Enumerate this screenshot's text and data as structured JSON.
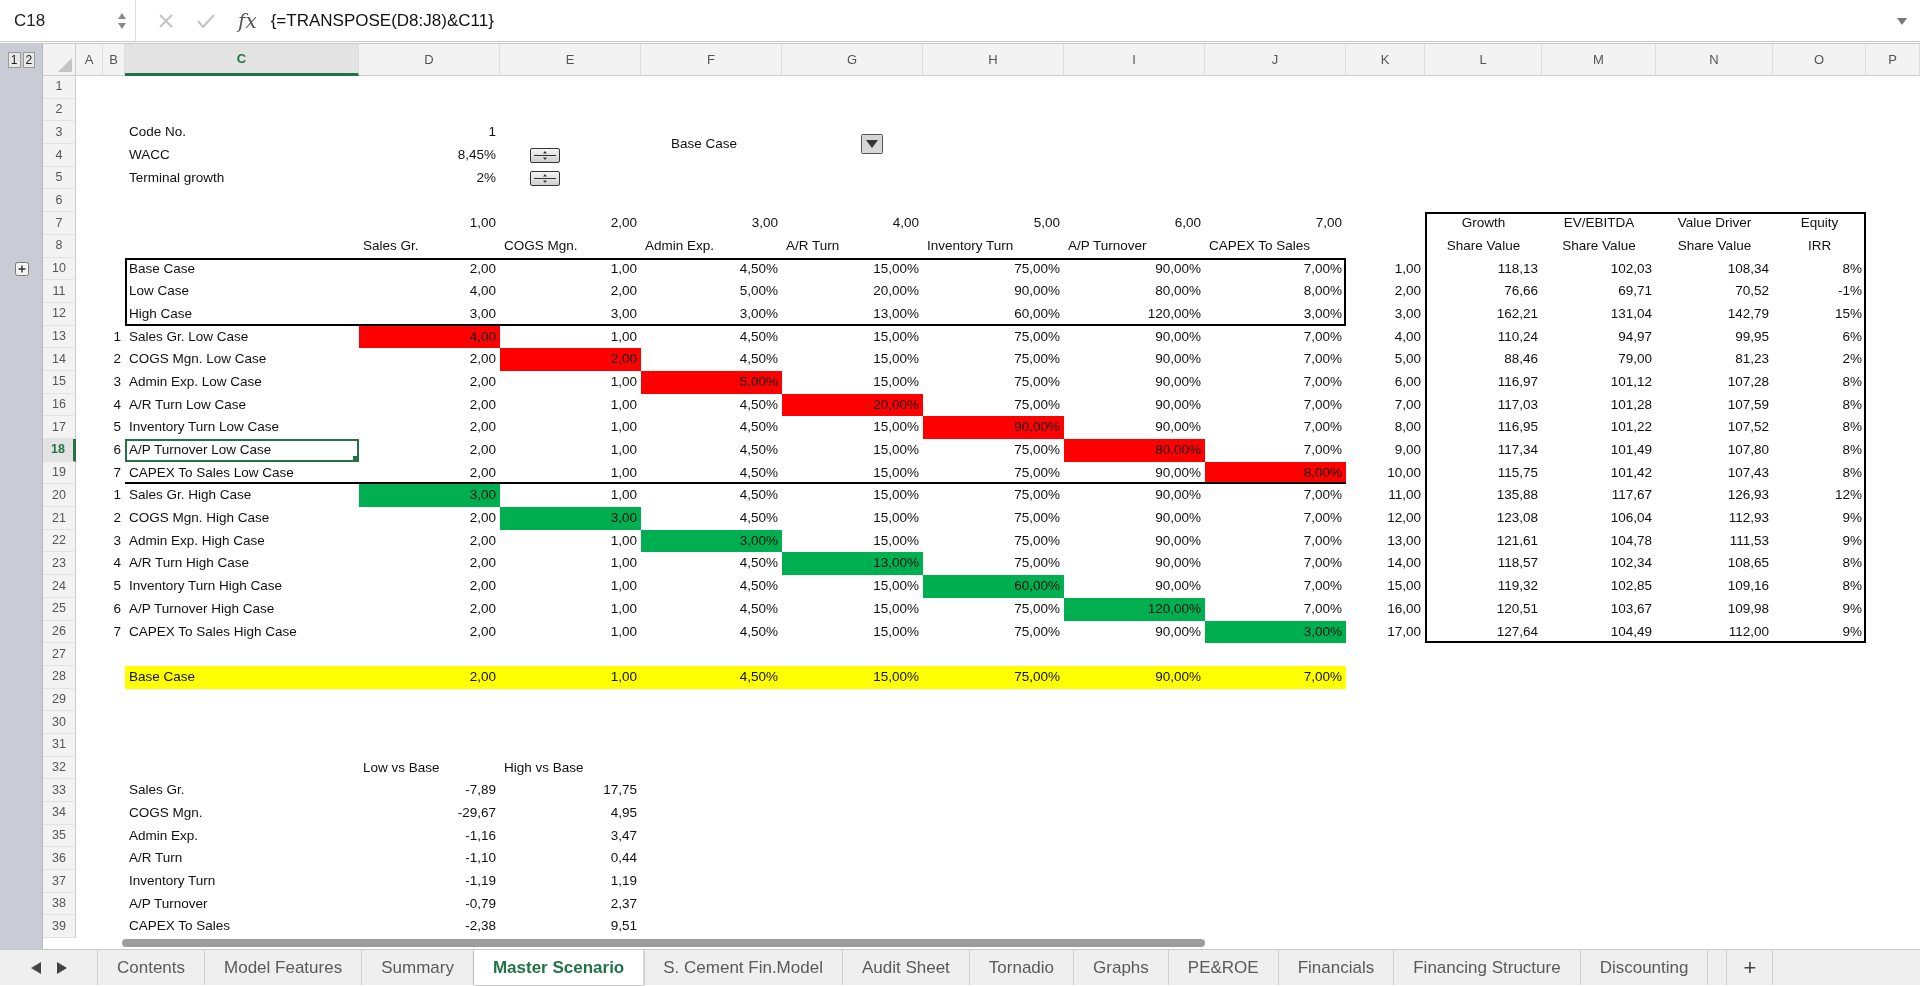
{
  "formula_bar": {
    "cell_reference": "C18",
    "function_label": "fx",
    "formula": "{=TRANSPOSE(D8:J8)&C11}"
  },
  "outline_levels": [
    "1",
    "2"
  ],
  "columns": [
    {
      "label": "A",
      "selected": false
    },
    {
      "label": "B",
      "selected": false
    },
    {
      "label": "C",
      "selected": true
    },
    {
      "label": "D",
      "selected": false
    },
    {
      "label": "E",
      "selected": false
    },
    {
      "label": "F",
      "selected": false
    },
    {
      "label": "G",
      "selected": false
    },
    {
      "label": "H",
      "selected": false
    },
    {
      "label": "I",
      "selected": false
    },
    {
      "label": "J",
      "selected": false
    },
    {
      "label": "K",
      "selected": false
    },
    {
      "label": "L",
      "selected": false
    },
    {
      "label": "M",
      "selected": false
    },
    {
      "label": "N",
      "selected": false
    },
    {
      "label": "O",
      "selected": false
    },
    {
      "label": "P",
      "selected": false
    }
  ],
  "rows": [
    {
      "number": "1",
      "selected": false,
      "cells": []
    },
    {
      "number": "2",
      "selected": false,
      "cells": []
    },
    {
      "number": "3",
      "selected": false,
      "cells": [
        {
          "kind": "blank"
        },
        {
          "kind": "blank"
        },
        {
          "kind": "text",
          "text": "Code No."
        },
        {
          "kind": "number",
          "text": "1"
        },
        {
          "kind": "blank"
        },
        {
          "kind": "dropdown",
          "text": "Base Case"
        }
      ]
    },
    {
      "number": "4",
      "selected": false,
      "cells": [
        {
          "kind": "blank"
        },
        {
          "kind": "blank"
        },
        {
          "kind": "text",
          "text": "WACC"
        },
        {
          "kind": "number",
          "text": "8,45%"
        },
        {
          "kind": "spinner"
        }
      ]
    },
    {
      "number": "5",
      "selected": false,
      "cells": [
        {
          "kind": "blank"
        },
        {
          "kind": "blank"
        },
        {
          "kind": "text",
          "text": "Terminal growth"
        },
        {
          "kind": "number",
          "text": "2%"
        },
        {
          "kind": "spinner"
        }
      ]
    },
    {
      "number": "6",
      "selected": false,
      "cells": []
    },
    {
      "number": "7",
      "selected": false,
      "cells": [
        {
          "kind": "blank"
        },
        {
          "kind": "blank"
        },
        {
          "kind": "blank"
        },
        {
          "kind": "number",
          "text": "1,00"
        },
        {
          "kind": "number",
          "text": "2,00"
        },
        {
          "kind": "number",
          "text": "3,00"
        },
        {
          "kind": "number",
          "text": "4,00"
        },
        {
          "kind": "number",
          "text": "5,00"
        },
        {
          "kind": "number",
          "text": "6,00"
        },
        {
          "kind": "number",
          "text": "7,00"
        },
        {
          "kind": "blank"
        },
        {
          "kind": "heading",
          "text": "Growth"
        },
        {
          "kind": "heading",
          "text": "EV/EBITDA"
        },
        {
          "kind": "heading",
          "text": "Value Driver"
        },
        {
          "kind": "heading",
          "text": "Equity"
        }
      ]
    },
    {
      "number": "8",
      "selected": false,
      "cells": [
        {
          "kind": "blank"
        },
        {
          "kind": "blank"
        },
        {
          "kind": "blank"
        },
        {
          "kind": "text",
          "text": "Sales Gr."
        },
        {
          "kind": "text",
          "text": "COGS Mgn."
        },
        {
          "kind": "text",
          "text": "Admin Exp."
        },
        {
          "kind": "text",
          "text": "A/R Turn"
        },
        {
          "kind": "text",
          "text": "Inventory Turn"
        },
        {
          "kind": "text",
          "text": "A/P Turnover"
        },
        {
          "kind": "text",
          "text": "CAPEX To Sales"
        },
        {
          "kind": "blank"
        },
        {
          "kind": "heading",
          "text": "Share Value"
        },
        {
          "kind": "heading",
          "text": "Share Value"
        },
        {
          "kind": "heading",
          "text": "Share Value"
        },
        {
          "kind": "heading",
          "text": "IRR"
        }
      ]
    },
    {
      "number": "10",
      "selected": false,
      "cells": [
        {
          "kind": "blank"
        },
        {
          "kind": "blank"
        },
        {
          "kind": "text",
          "text": "Base Case"
        },
        {
          "kind": "number",
          "text": "2,00"
        },
        {
          "kind": "number",
          "text": "1,00"
        },
        {
          "kind": "number",
          "text": "4,50%"
        },
        {
          "kind": "number",
          "text": "15,00%"
        },
        {
          "kind": "number",
          "text": "75,00%"
        },
        {
          "kind": "number",
          "text": "90,00%"
        },
        {
          "kind": "number",
          "text": "7,00%"
        },
        {
          "kind": "number",
          "text": "1,00"
        },
        {
          "kind": "number",
          "text": "118,13"
        },
        {
          "kind": "number",
          "text": "102,03"
        },
        {
          "kind": "number",
          "text": "108,34"
        },
        {
          "kind": "number",
          "text": "8%"
        }
      ]
    },
    {
      "number": "11",
      "selected": false,
      "cells": [
        {
          "kind": "blank"
        },
        {
          "kind": "blank"
        },
        {
          "kind": "text",
          "text": "Low Case"
        },
        {
          "kind": "number",
          "text": "4,00"
        },
        {
          "kind": "number",
          "text": "2,00"
        },
        {
          "kind": "number",
          "text": "5,00%"
        },
        {
          "kind": "number",
          "text": "20,00%"
        },
        {
          "kind": "number",
          "text": "90,00%"
        },
        {
          "kind": "number",
          "text": "80,00%"
        },
        {
          "kind": "number",
          "text": "8,00%"
        },
        {
          "kind": "number",
          "text": "2,00"
        },
        {
          "kind": "number",
          "text": "76,66"
        },
        {
          "kind": "number",
          "text": "69,71"
        },
        {
          "kind": "number",
          "text": "70,52"
        },
        {
          "kind": "number",
          "text": "-1%"
        }
      ]
    },
    {
      "number": "12",
      "selected": false,
      "cells": [
        {
          "kind": "blank"
        },
        {
          "kind": "blank"
        },
        {
          "kind": "text",
          "text": "High Case"
        },
        {
          "kind": "number",
          "text": "3,00"
        },
        {
          "kind": "number",
          "text": "3,00"
        },
        {
          "kind": "number",
          "text": "3,00%"
        },
        {
          "kind": "number",
          "text": "13,00%"
        },
        {
          "kind": "number",
          "text": "60,00%"
        },
        {
          "kind": "number",
          "text": "120,00%"
        },
        {
          "kind": "number",
          "text": "3,00%"
        },
        {
          "kind": "number",
          "text": "3,00"
        },
        {
          "kind": "number",
          "text": "162,21"
        },
        {
          "kind": "number",
          "text": "131,04"
        },
        {
          "kind": "number",
          "text": "142,79"
        },
        {
          "kind": "number",
          "text": "15%"
        }
      ]
    },
    {
      "number": "13",
      "selected": false,
      "cells": [
        {
          "kind": "blank"
        },
        {
          "kind": "number",
          "text": "1"
        },
        {
          "kind": "text",
          "text": "Sales Gr. Low Case"
        },
        {
          "kind": "number",
          "text": "4,00",
          "color": "#ff0000"
        },
        {
          "kind": "number",
          "text": "1,00"
        },
        {
          "kind": "number",
          "text": "4,50%"
        },
        {
          "kind": "number",
          "text": "15,00%"
        },
        {
          "kind": "number",
          "text": "75,00%"
        },
        {
          "kind": "number",
          "text": "90,00%"
        },
        {
          "kind": "number",
          "text": "7,00%"
        },
        {
          "kind": "number",
          "text": "4,00"
        },
        {
          "kind": "number",
          "text": "110,24"
        },
        {
          "kind": "number",
          "text": "94,97"
        },
        {
          "kind": "number",
          "text": "99,95"
        },
        {
          "kind": "number",
          "text": "6%"
        }
      ]
    },
    {
      "number": "14",
      "selected": false,
      "cells": [
        {
          "kind": "blank"
        },
        {
          "kind": "number",
          "text": "2"
        },
        {
          "kind": "text",
          "text": "COGS Mgn. Low Case"
        },
        {
          "kind": "number",
          "text": "2,00"
        },
        {
          "kind": "number",
          "text": "2,00",
          "color": "#ff0000"
        },
        {
          "kind": "number",
          "text": "4,50%"
        },
        {
          "kind": "number",
          "text": "15,00%"
        },
        {
          "kind": "number",
          "text": "75,00%"
        },
        {
          "kind": "number",
          "text": "90,00%"
        },
        {
          "kind": "number",
          "text": "7,00%"
        },
        {
          "kind": "number",
          "text": "5,00"
        },
        {
          "kind": "number",
          "text": "88,46"
        },
        {
          "kind": "number",
          "text": "79,00"
        },
        {
          "kind": "number",
          "text": "81,23"
        },
        {
          "kind": "number",
          "text": "2%"
        }
      ]
    },
    {
      "number": "15",
      "selected": false,
      "cells": [
        {
          "kind": "blank"
        },
        {
          "kind": "number",
          "text": "3"
        },
        {
          "kind": "text",
          "text": "Admin Exp. Low Case"
        },
        {
          "kind": "number",
          "text": "2,00"
        },
        {
          "kind": "number",
          "text": "1,00"
        },
        {
          "kind": "number",
          "text": "5,00%",
          "color": "#ff0000"
        },
        {
          "kind": "number",
          "text": "15,00%"
        },
        {
          "kind": "number",
          "text": "75,00%"
        },
        {
          "kind": "number",
          "text": "90,00%"
        },
        {
          "kind": "number",
          "text": "7,00%"
        },
        {
          "kind": "number",
          "text": "6,00"
        },
        {
          "kind": "number",
          "text": "116,97"
        },
        {
          "kind": "number",
          "text": "101,12"
        },
        {
          "kind": "number",
          "text": "107,28"
        },
        {
          "kind": "number",
          "text": "8%"
        }
      ]
    },
    {
      "number": "16",
      "selected": false,
      "cells": [
        {
          "kind": "blank"
        },
        {
          "kind": "number",
          "text": "4"
        },
        {
          "kind": "text",
          "text": "A/R Turn Low Case"
        },
        {
          "kind": "number",
          "text": "2,00"
        },
        {
          "kind": "number",
          "text": "1,00"
        },
        {
          "kind": "number",
          "text": "4,50%"
        },
        {
          "kind": "number",
          "text": "20,00%",
          "color": "#ff0000"
        },
        {
          "kind": "number",
          "text": "75,00%"
        },
        {
          "kind": "number",
          "text": "90,00%"
        },
        {
          "kind": "number",
          "text": "7,00%"
        },
        {
          "kind": "number",
          "text": "7,00"
        },
        {
          "kind": "number",
          "text": "117,03"
        },
        {
          "kind": "number",
          "text": "101,28"
        },
        {
          "kind": "number",
          "text": "107,59"
        },
        {
          "kind": "number",
          "text": "8%"
        }
      ]
    },
    {
      "number": "17",
      "selected": false,
      "cells": [
        {
          "kind": "blank"
        },
        {
          "kind": "number",
          "text": "5"
        },
        {
          "kind": "text",
          "text": "Inventory Turn Low Case"
        },
        {
          "kind": "number",
          "text": "2,00"
        },
        {
          "kind": "number",
          "text": "1,00"
        },
        {
          "kind": "number",
          "text": "4,50%"
        },
        {
          "kind": "number",
          "text": "15,00%"
        },
        {
          "kind": "number",
          "text": "90,00%",
          "color": "#ff0000"
        },
        {
          "kind": "number",
          "text": "90,00%"
        },
        {
          "kind": "number",
          "text": "7,00%"
        },
        {
          "kind": "number",
          "text": "8,00"
        },
        {
          "kind": "number",
          "text": "116,95"
        },
        {
          "kind": "number",
          "text": "101,22"
        },
        {
          "kind": "number",
          "text": "107,52"
        },
        {
          "kind": "number",
          "text": "8%"
        }
      ]
    },
    {
      "number": "18",
      "selected": true,
      "cells": [
        {
          "kind": "blank"
        },
        {
          "kind": "number",
          "text": "6"
        },
        {
          "kind": "text",
          "text": "A/P Turnover Low Case"
        },
        {
          "kind": "number",
          "text": "2,00"
        },
        {
          "kind": "number",
          "text": "1,00"
        },
        {
          "kind": "number",
          "text": "4,50%"
        },
        {
          "kind": "number",
          "text": "15,00%"
        },
        {
          "kind": "number",
          "text": "75,00%"
        },
        {
          "kind": "number",
          "text": "80,00%",
          "color": "#ff0000"
        },
        {
          "kind": "number",
          "text": "7,00%"
        },
        {
          "kind": "number",
          "text": "9,00"
        },
        {
          "kind": "number",
          "text": "117,34"
        },
        {
          "kind": "number",
          "text": "101,49"
        },
        {
          "kind": "number",
          "text": "107,80"
        },
        {
          "kind": "number",
          "text": "8%"
        }
      ]
    },
    {
      "number": "19",
      "selected": false,
      "cells": [
        {
          "kind": "blank"
        },
        {
          "kind": "number",
          "text": "7"
        },
        {
          "kind": "text",
          "text": "CAPEX To Sales Low Case"
        },
        {
          "kind": "number",
          "text": "2,00"
        },
        {
          "kind": "number",
          "text": "1,00"
        },
        {
          "kind": "number",
          "text": "4,50%"
        },
        {
          "kind": "number",
          "text": "15,00%"
        },
        {
          "kind": "number",
          "text": "75,00%"
        },
        {
          "kind": "number",
          "text": "90,00%"
        },
        {
          "kind": "number",
          "text": "8,00%",
          "color": "#ff0000"
        },
        {
          "kind": "number",
          "text": "10,00"
        },
        {
          "kind": "number",
          "text": "115,75"
        },
        {
          "kind": "number",
          "text": "101,42"
        },
        {
          "kind": "number",
          "text": "107,43"
        },
        {
          "kind": "number",
          "text": "8%"
        }
      ]
    },
    {
      "number": "20",
      "selected": false,
      "cells": [
        {
          "kind": "blank"
        },
        {
          "kind": "number",
          "text": "1"
        },
        {
          "kind": "text",
          "text": "Sales Gr. High Case"
        },
        {
          "kind": "number",
          "text": "3,00",
          "color": "#00b050"
        },
        {
          "kind": "number",
          "text": "1,00"
        },
        {
          "kind": "number",
          "text": "4,50%"
        },
        {
          "kind": "number",
          "text": "15,00%"
        },
        {
          "kind": "number",
          "text": "75,00%"
        },
        {
          "kind": "number",
          "text": "90,00%"
        },
        {
          "kind": "number",
          "text": "7,00%"
        },
        {
          "kind": "number",
          "text": "11,00"
        },
        {
          "kind": "number",
          "text": "135,88"
        },
        {
          "kind": "number",
          "text": "117,67"
        },
        {
          "kind": "number",
          "text": "126,93"
        },
        {
          "kind": "number",
          "text": "12%"
        }
      ]
    },
    {
      "number": "21",
      "selected": false,
      "cells": [
        {
          "kind": "blank"
        },
        {
          "kind": "number",
          "text": "2"
        },
        {
          "kind": "text",
          "text": "COGS Mgn. High Case"
        },
        {
          "kind": "number",
          "text": "2,00"
        },
        {
          "kind": "number",
          "text": "3,00",
          "color": "#00b050"
        },
        {
          "kind": "number",
          "text": "4,50%"
        },
        {
          "kind": "number",
          "text": "15,00%"
        },
        {
          "kind": "number",
          "text": "75,00%"
        },
        {
          "kind": "number",
          "text": "90,00%"
        },
        {
          "kind": "number",
          "text": "7,00%"
        },
        {
          "kind": "number",
          "text": "12,00"
        },
        {
          "kind": "number",
          "text": "123,08"
        },
        {
          "kind": "number",
          "text": "106,04"
        },
        {
          "kind": "number",
          "text": "112,93"
        },
        {
          "kind": "number",
          "text": "9%"
        }
      ]
    },
    {
      "number": "22",
      "selected": false,
      "cells": [
        {
          "kind": "blank"
        },
        {
          "kind": "number",
          "text": "3"
        },
        {
          "kind": "text",
          "text": "Admin Exp. High Case"
        },
        {
          "kind": "number",
          "text": "2,00"
        },
        {
          "kind": "number",
          "text": "1,00"
        },
        {
          "kind": "number",
          "text": "3,00%",
          "color": "#00b050"
        },
        {
          "kind": "number",
          "text": "15,00%"
        },
        {
          "kind": "number",
          "text": "75,00%"
        },
        {
          "kind": "number",
          "text": "90,00%"
        },
        {
          "kind": "number",
          "text": "7,00%"
        },
        {
          "kind": "number",
          "text": "13,00"
        },
        {
          "kind": "number",
          "text": "121,61"
        },
        {
          "kind": "number",
          "text": "104,78"
        },
        {
          "kind": "number",
          "text": "111,53"
        },
        {
          "kind": "number",
          "text": "9%"
        }
      ]
    },
    {
      "number": "23",
      "selected": false,
      "cells": [
        {
          "kind": "blank"
        },
        {
          "kind": "number",
          "text": "4"
        },
        {
          "kind": "text",
          "text": "A/R Turn High Case"
        },
        {
          "kind": "number",
          "text": "2,00"
        },
        {
          "kind": "number",
          "text": "1,00"
        },
        {
          "kind": "number",
          "text": "4,50%"
        },
        {
          "kind": "number",
          "text": "13,00%",
          "color": "#00b050"
        },
        {
          "kind": "number",
          "text": "75,00%"
        },
        {
          "kind": "number",
          "text": "90,00%"
        },
        {
          "kind": "number",
          "text": "7,00%"
        },
        {
          "kind": "number",
          "text": "14,00"
        },
        {
          "kind": "number",
          "text": "118,57"
        },
        {
          "kind": "number",
          "text": "102,34"
        },
        {
          "kind": "number",
          "text": "108,65"
        },
        {
          "kind": "number",
          "text": "8%"
        }
      ]
    },
    {
      "number": "24",
      "selected": false,
      "cells": [
        {
          "kind": "blank"
        },
        {
          "kind": "number",
          "text": "5"
        },
        {
          "kind": "text",
          "text": "Inventory Turn High Case"
        },
        {
          "kind": "number",
          "text": "2,00"
        },
        {
          "kind": "number",
          "text": "1,00"
        },
        {
          "kind": "number",
          "text": "4,50%"
        },
        {
          "kind": "number",
          "text": "15,00%"
        },
        {
          "kind": "number",
          "text": "60,00%",
          "color": "#00b050"
        },
        {
          "kind": "number",
          "text": "90,00%"
        },
        {
          "kind": "number",
          "text": "7,00%"
        },
        {
          "kind": "number",
          "text": "15,00"
        },
        {
          "kind": "number",
          "text": "119,32"
        },
        {
          "kind": "number",
          "text": "102,85"
        },
        {
          "kind": "number",
          "text": "109,16"
        },
        {
          "kind": "number",
          "text": "8%"
        }
      ]
    },
    {
      "number": "25",
      "selected": false,
      "cells": [
        {
          "kind": "blank"
        },
        {
          "kind": "number",
          "text": "6"
        },
        {
          "kind": "text",
          "text": "A/P Turnover High Case"
        },
        {
          "kind": "number",
          "text": "2,00"
        },
        {
          "kind": "number",
          "text": "1,00"
        },
        {
          "kind": "number",
          "text": "4,50%"
        },
        {
          "kind": "number",
          "text": "15,00%"
        },
        {
          "kind": "number",
          "text": "75,00%"
        },
        {
          "kind": "number",
          "text": "120,00%",
          "color": "#00b050"
        },
        {
          "kind": "number",
          "text": "7,00%"
        },
        {
          "kind": "number",
          "text": "16,00"
        },
        {
          "kind": "number",
          "text": "120,51"
        },
        {
          "kind": "number",
          "text": "103,67"
        },
        {
          "kind": "number",
          "text": "109,98"
        },
        {
          "kind": "number",
          "text": "9%"
        }
      ]
    },
    {
      "number": "26",
      "selected": false,
      "cells": [
        {
          "kind": "blank"
        },
        {
          "kind": "number",
          "text": "7"
        },
        {
          "kind": "text",
          "text": "CAPEX To Sales High Case"
        },
        {
          "kind": "number",
          "text": "2,00"
        },
        {
          "kind": "number",
          "text": "1,00"
        },
        {
          "kind": "number",
          "text": "4,50%"
        },
        {
          "kind": "number",
          "text": "15,00%"
        },
        {
          "kind": "number",
          "text": "75,00%"
        },
        {
          "kind": "number",
          "text": "90,00%"
        },
        {
          "kind": "number",
          "text": "3,00%",
          "color": "#00b050"
        },
        {
          "kind": "number",
          "text": "17,00"
        },
        {
          "kind": "number",
          "text": "127,64"
        },
        {
          "kind": "number",
          "text": "104,49"
        },
        {
          "kind": "number",
          "text": "112,00"
        },
        {
          "kind": "number",
          "text": "9%"
        }
      ]
    },
    {
      "number": "27",
      "selected": false,
      "cells": []
    },
    {
      "number": "28",
      "selected": false,
      "cells": [
        {
          "kind": "blank"
        },
        {
          "kind": "blank"
        },
        {
          "kind": "text",
          "text": "Base Case",
          "color": "#ffff00"
        },
        {
          "kind": "number",
          "text": "2,00",
          "color": "#ffff00"
        },
        {
          "kind": "number",
          "text": "1,00",
          "color": "#ffff00"
        },
        {
          "kind": "number",
          "text": "4,50%",
          "color": "#ffff00"
        },
        {
          "kind": "number",
          "text": "15,00%",
          "color": "#ffff00"
        },
        {
          "kind": "number",
          "text": "75,00%",
          "color": "#ffff00"
        },
        {
          "kind": "number",
          "text": "90,00%",
          "color": "#ffff00"
        },
        {
          "kind": "number",
          "text": "7,00%",
          "color": "#ffff00"
        }
      ]
    },
    {
      "number": "29",
      "selected": false,
      "cells": []
    },
    {
      "number": "30",
      "selected": false,
      "cells": []
    },
    {
      "number": "31",
      "selected": false,
      "cells": []
    },
    {
      "number": "32",
      "selected": false,
      "cells": [
        {
          "kind": "blank"
        },
        {
          "kind": "blank"
        },
        {
          "kind": "blank"
        },
        {
          "kind": "text",
          "text": "Low vs Base"
        },
        {
          "kind": "text",
          "text": "High vs Base"
        }
      ]
    },
    {
      "number": "33",
      "selected": false,
      "cells": [
        {
          "kind": "blank"
        },
        {
          "kind": "blank"
        },
        {
          "kind": "text",
          "text": "Sales Gr."
        },
        {
          "kind": "number",
          "text": "-7,89"
        },
        {
          "kind": "number",
          "text": "17,75"
        }
      ]
    },
    {
      "number": "34",
      "selected": false,
      "cells": [
        {
          "kind": "blank"
        },
        {
          "kind": "blank"
        },
        {
          "kind": "text",
          "text": "COGS Mgn."
        },
        {
          "kind": "number",
          "text": "-29,67"
        },
        {
          "kind": "number",
          "text": "4,95"
        }
      ]
    },
    {
      "number": "35",
      "selected": false,
      "cells": [
        {
          "kind": "blank"
        },
        {
          "kind": "blank"
        },
        {
          "kind": "text",
          "text": "Admin Exp."
        },
        {
          "kind": "number",
          "text": "-1,16"
        },
        {
          "kind": "number",
          "text": "3,47"
        }
      ]
    },
    {
      "number": "36",
      "selected": false,
      "cells": [
        {
          "kind": "blank"
        },
        {
          "kind": "blank"
        },
        {
          "kind": "text",
          "text": "A/R Turn"
        },
        {
          "kind": "number",
          "text": "-1,10"
        },
        {
          "kind": "number",
          "text": "0,44"
        }
      ]
    },
    {
      "number": "37",
      "selected": false,
      "cells": [
        {
          "kind": "blank"
        },
        {
          "kind": "blank"
        },
        {
          "kind": "text",
          "text": "Inventory Turn"
        },
        {
          "kind": "number",
          "text": "-1,19"
        },
        {
          "kind": "number",
          "text": "1,19"
        }
      ]
    },
    {
      "number": "38",
      "selected": false,
      "cells": [
        {
          "kind": "blank"
        },
        {
          "kind": "blank"
        },
        {
          "kind": "text",
          "text": "A/P Turnover"
        },
        {
          "kind": "number",
          "text": "-0,79"
        },
        {
          "kind": "number",
          "text": "2,37"
        }
      ]
    },
    {
      "number": "39",
      "selected": false,
      "cells": [
        {
          "kind": "blank"
        },
        {
          "kind": "blank"
        },
        {
          "kind": "text",
          "text": "CAPEX To Sales"
        },
        {
          "kind": "number",
          "text": "-2,38"
        },
        {
          "kind": "number",
          "text": "9,51"
        }
      ]
    }
  ],
  "sheet_tabs": [
    {
      "label": "Contents",
      "selected": false
    },
    {
      "label": "Model Features",
      "selected": false
    },
    {
      "label": "Summary",
      "selected": false
    },
    {
      "label": "Master Scenario",
      "selected": true
    },
    {
      "label": "S. Cement Fin.Model",
      "selected": false
    },
    {
      "label": "Audit Sheet",
      "selected": false
    },
    {
      "label": "Tornadio",
      "selected": false
    },
    {
      "label": "Graphs",
      "selected": false
    },
    {
      "label": "PE&ROE",
      "selected": false
    },
    {
      "label": "Financials",
      "selected": false
    },
    {
      "label": "Financing Structure",
      "selected": false
    },
    {
      "label": "Discounting",
      "selected": false
    }
  ],
  "add_sheet_label": "+"
}
